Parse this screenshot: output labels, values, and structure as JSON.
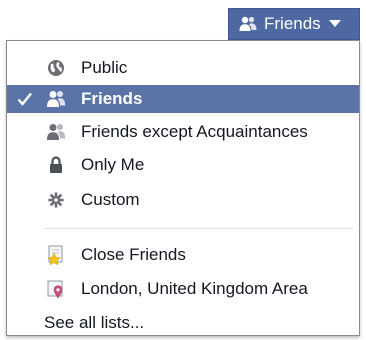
{
  "button": {
    "label": "Friends",
    "icon": "friends-icon",
    "caret": "chevron-down-icon",
    "bg_color": "#4e69a2"
  },
  "menu": {
    "items": [
      {
        "label": "Public",
        "icon": "globe-icon",
        "selected": false
      },
      {
        "label": "Friends",
        "icon": "friends-icon",
        "selected": true
      },
      {
        "label": "Friends except Acquaintances",
        "icon": "friends-except-icon",
        "selected": false
      },
      {
        "label": "Only Me",
        "icon": "lock-icon",
        "selected": false
      },
      {
        "label": "Custom",
        "icon": "gear-icon",
        "selected": false
      }
    ],
    "lists": [
      {
        "label": "Close Friends",
        "icon": "star-list-icon"
      },
      {
        "label": "London, United Kingdom Area",
        "icon": "location-pin-icon"
      }
    ],
    "see_all": "See all lists...",
    "selected_bg": "#5b74a8"
  }
}
